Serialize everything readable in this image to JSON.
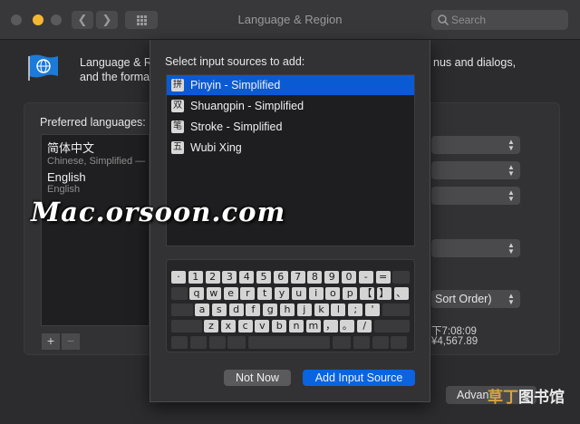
{
  "window": {
    "title": "Language & Region"
  },
  "toolbar": {
    "back_icon": "chevron-left",
    "forward_icon": "chevron-right",
    "grid_icon": "grid"
  },
  "search": {
    "placeholder": "Search"
  },
  "pane": {
    "header_line1": "Language & R",
    "header_line1_right": "nus and dialogs,",
    "header_line2": "and the forma",
    "preferred_label": "Preferred languages:",
    "languages": [
      {
        "name": "简体中文",
        "sub": "Chinese, Simplified —"
      },
      {
        "name": "English",
        "sub": "English"
      }
    ],
    "add_label": "+",
    "remove_label": "−",
    "popups": [
      "",
      "",
      "",
      "",
      "Sort Order)"
    ],
    "time_sample": "下7:08:09",
    "number_sample": "¥4,567.89",
    "advanced_label": "Advan"
  },
  "sheet": {
    "title": "Select input sources to add:",
    "sources": [
      {
        "icon": "拼",
        "label": "Pinyin - Simplified",
        "selected": true
      },
      {
        "icon": "双",
        "label": "Shuangpin - Simplified",
        "selected": false
      },
      {
        "icon": "笔",
        "label": "Stroke - Simplified",
        "selected": false
      },
      {
        "icon": "五",
        "label": "Wubi Xing",
        "selected": false
      }
    ],
    "keyboard": {
      "row1": [
        "·",
        "1",
        "2",
        "3",
        "4",
        "5",
        "6",
        "7",
        "8",
        "9",
        "0",
        "-",
        "="
      ],
      "row2": [
        "q",
        "w",
        "e",
        "r",
        "t",
        "y",
        "u",
        "i",
        "o",
        "p",
        "【",
        "】",
        "、"
      ],
      "row3": [
        "a",
        "s",
        "d",
        "f",
        "g",
        "h",
        "j",
        "k",
        "l",
        ";",
        "'"
      ],
      "row4": [
        "z",
        "x",
        "c",
        "v",
        "b",
        "n",
        "m",
        "，",
        "。",
        "/"
      ]
    },
    "not_now_label": "Not Now",
    "add_source_label": "Add Input Source"
  },
  "watermark": {
    "text": "Mac.orsoon.com",
    "logo_a": "草丁",
    "logo_b": "图书馆"
  },
  "colors": {
    "accent": "#0a64e0",
    "selection": "#0a5ad4",
    "window_bg": "#2c2c2e"
  }
}
